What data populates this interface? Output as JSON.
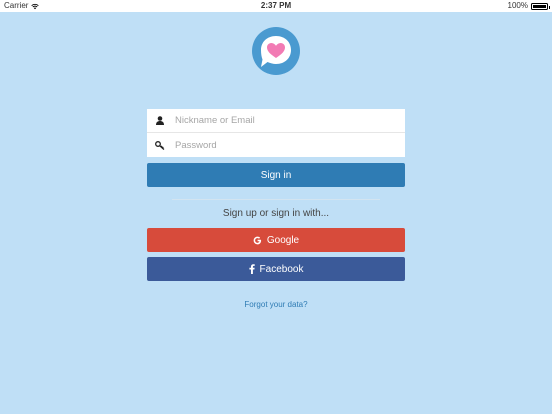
{
  "status_bar": {
    "carrier": "Carrier",
    "time": "2:37 PM",
    "battery": "100%"
  },
  "colors": {
    "background": "#bfdff6",
    "sign_in": "#2f7cb4",
    "google": "#d74b3b",
    "facebook": "#3b5a99",
    "logo_circle": "#4a9ad0",
    "heart": "#f27bb4"
  },
  "login": {
    "nickname_placeholder": "Nickname or Email",
    "password_placeholder": "Password",
    "sign_in_label": "Sign in",
    "signup_prompt": "Sign up or sign in with...",
    "google_label": "Google",
    "facebook_label": "Facebook",
    "forgot_label": "Forgot your data?"
  },
  "icons": {
    "logo": "chat-bubble-heart-icon",
    "user": "user-icon",
    "key": "key-icon",
    "google": "google-icon",
    "facebook": "facebook-icon",
    "wifi": "wifi-icon",
    "battery": "battery-icon"
  }
}
